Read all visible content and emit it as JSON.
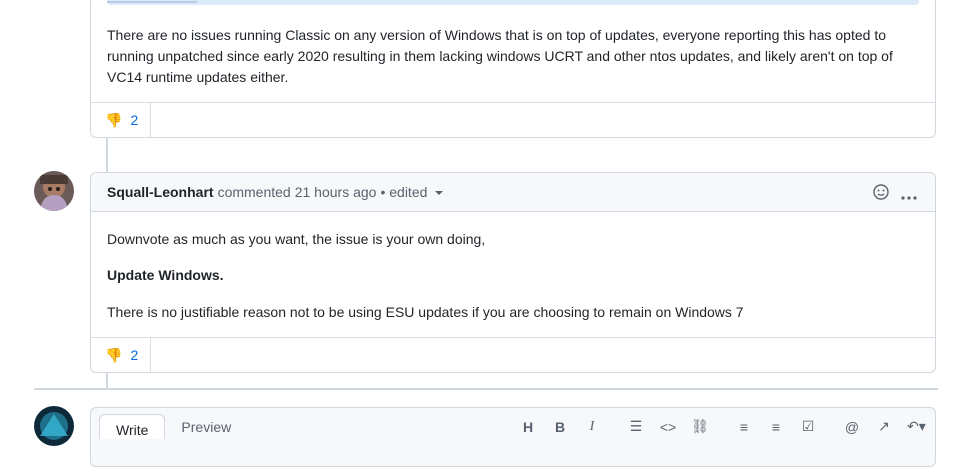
{
  "comment1": {
    "body": "There are no issues running Classic on any version of Windows that is on top of updates, everyone reporting this has opted to running unpatched since early 2020 resulting in them lacking windows UCRT and other ntos updates, and likely aren't on top of VC14 runtime updates either.",
    "reaction_count": "2"
  },
  "comment2": {
    "author": "Squall-Leonhart",
    "action": "commented",
    "date": "21 hours ago",
    "edited": "• edited",
    "line1": "Downvote as much as you want, the issue is your own doing,",
    "line2": "Update Windows.",
    "line3": "There is no justifiable reason not to be using ESU updates if you are choosing to remain on Windows 7",
    "reaction_count": "2"
  },
  "editor": {
    "write_tab": "Write",
    "preview_tab": "Preview"
  },
  "colors": {
    "accent": "#0969da",
    "border": "#d0d7de",
    "thumb": "#bf8700"
  }
}
